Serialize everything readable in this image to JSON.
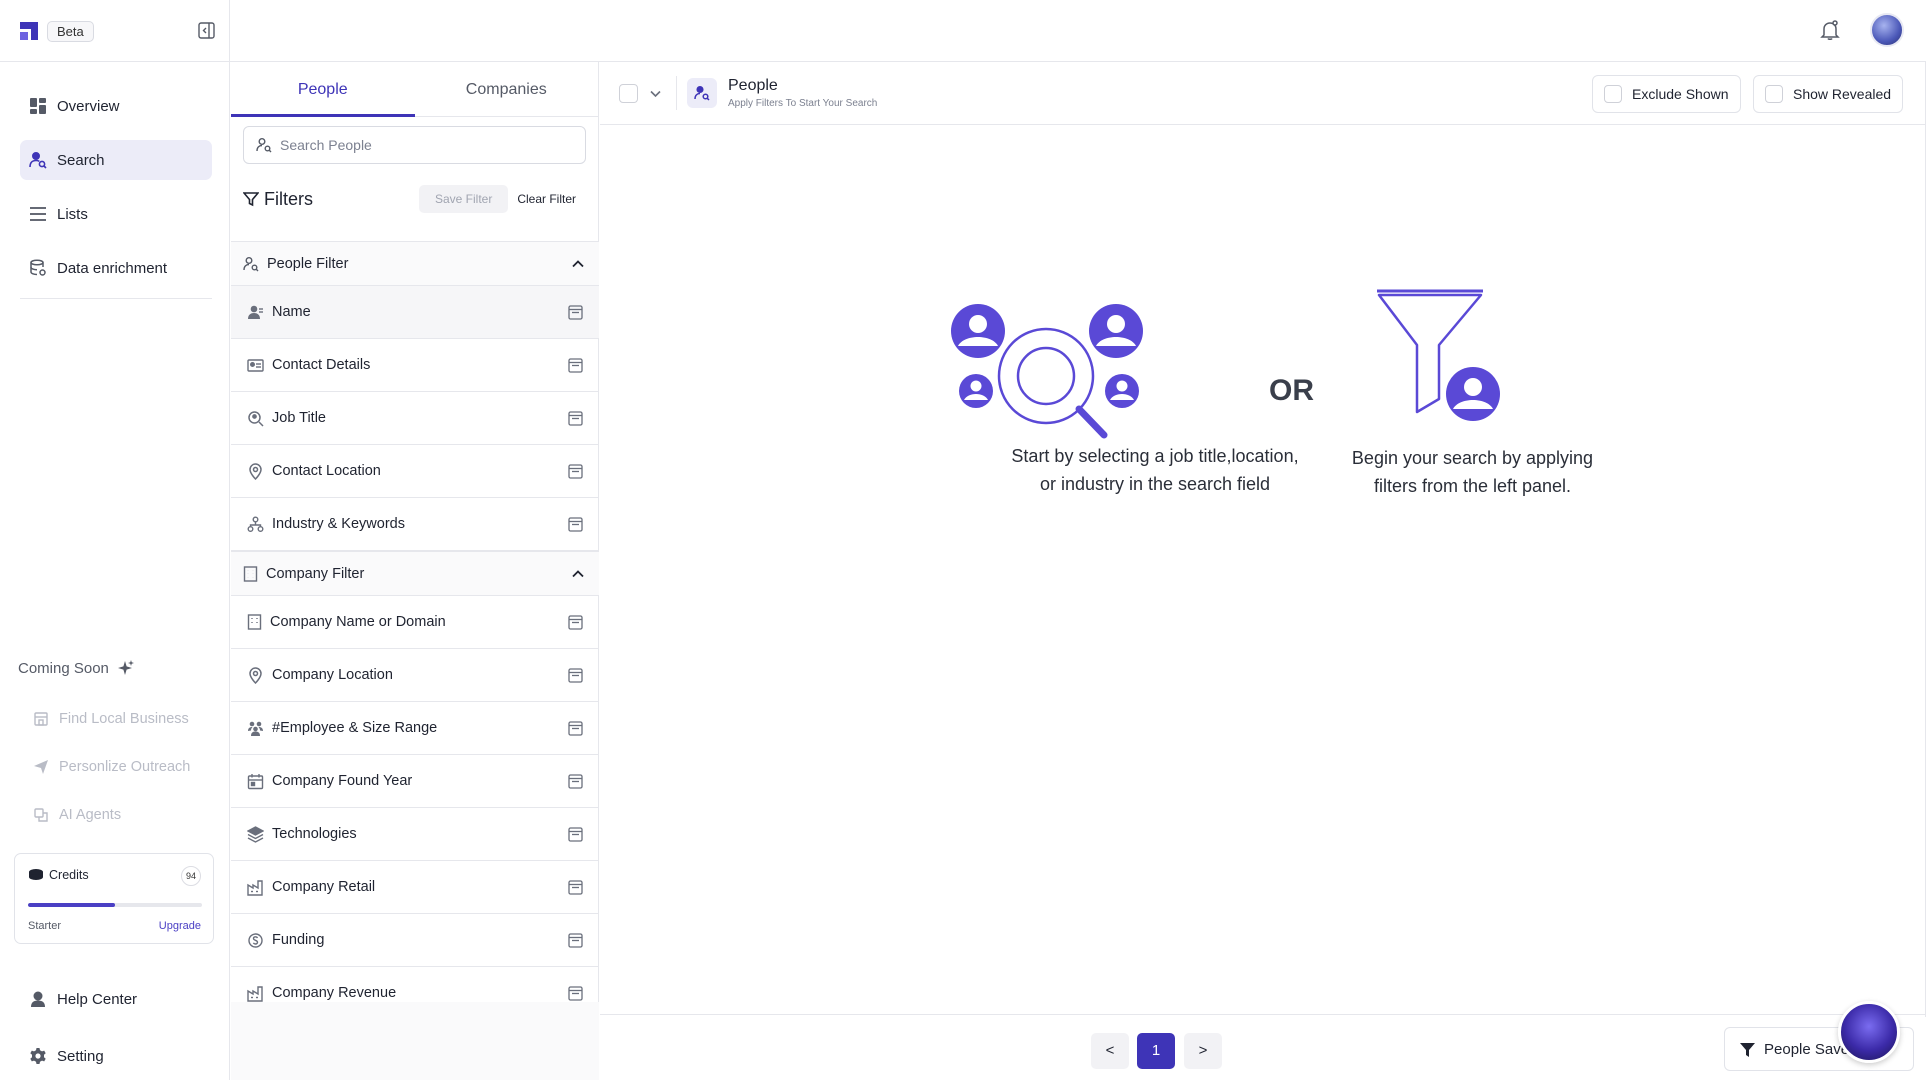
{
  "brand": {
    "badge": "Beta"
  },
  "nav": [
    {
      "label": "Overview",
      "icon": "grid-icon"
    },
    {
      "label": "Search",
      "icon": "user-search-icon",
      "active": true
    },
    {
      "label": "Lists",
      "icon": "list-icon"
    },
    {
      "label": "Data enrichment",
      "icon": "database-icon"
    }
  ],
  "coming_soon": {
    "label": "Coming Soon",
    "items": [
      "Find Local Business",
      "Personlize Outreach",
      "AI Agents"
    ]
  },
  "credits": {
    "label": "Credits",
    "count": "94",
    "plan": "Starter",
    "upgrade": "Upgrade",
    "usage_fraction": 0.5
  },
  "bottom_nav": {
    "help": "Help Center",
    "setting": "Setting"
  },
  "panel": {
    "tabs": [
      "People",
      "Companies"
    ],
    "search_placeholder": "Search People",
    "filters_title": "Filters",
    "save_filter": "Save Filter",
    "clear_filter": "Clear Filter",
    "people_group": "People Filter",
    "people_filters": [
      "Name",
      "Contact Details",
      "Job Title",
      "Contact Location",
      "Industry & Keywords"
    ],
    "company_group": "Company Filter",
    "company_filters": [
      "Company Name or Domain",
      "Company Location",
      "#Employee & Size Range",
      "Company Found Year",
      "Technologies",
      "Company Retail",
      "Funding",
      "Company Revenue"
    ]
  },
  "main": {
    "title": "People",
    "subtitle": "Apply Filters To Start Your Search",
    "exclude_shown": "Exclude Shown",
    "show_revealed": "Show Revealed",
    "or_text": "OR",
    "msg_left_1": "Start by selecting a job title,location,",
    "msg_left_2": "or industry in the search field",
    "msg_right_1": "Begin your search by applying",
    "msg_right_2": "filters from the left panel.",
    "pagination": {
      "prev": "<",
      "current": "1",
      "next": ">"
    },
    "saved_button": "People Saved"
  },
  "colors": {
    "accent": "#3e34b7",
    "illustration": "#5a49d6"
  }
}
